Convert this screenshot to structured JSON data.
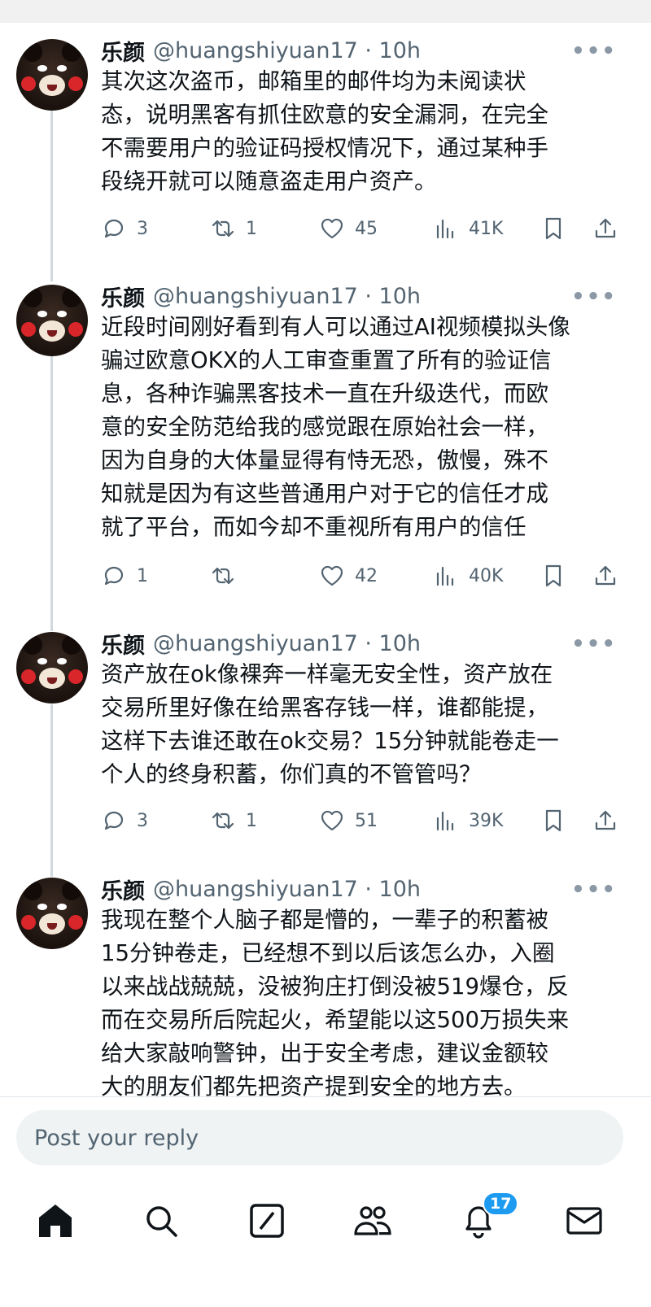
{
  "tweets": [
    {
      "name": "乐颜",
      "handle": "@huangshiyuan17 · 10h",
      "text": "其次这次盗币，邮箱里的邮件均为未阅读状\n态，说明黑客有抓住欧意的安全漏洞，在完全\n不需要用户的验证码授权情况下，通过某种手\n段绕开就可以随意盗走用户资产。",
      "replies": "3",
      "reposts": "1",
      "likes": "45",
      "views": "41K"
    },
    {
      "name": "乐颜",
      "handle": "@huangshiyuan17 · 10h",
      "text": "近段时间刚好看到有人可以通过AI视频模拟头像\n骗过欧意OKX的人工审查重置了所有的验证信\n息，各种诈骗黑客技术一直在升级迭代，而欧\n意的安全防范给我的感觉跟在原始社会一样，\n因为自身的大体量显得有恃无恐，傲慢，殊不\n知就是因为有这些普通用户对于它的信任才成\n就了平台，而如今却不重视所有用户的信任",
      "replies": "1",
      "reposts": "",
      "likes": "42",
      "views": "40K"
    },
    {
      "name": "乐颜",
      "handle": "@huangshiyuan17 · 10h",
      "text": "资产放在ok像裸奔一样毫无安全性，资产放在\n交易所里好像在给黑客存钱一样，谁都能提，\n这样下去谁还敢在ok交易？15分钟就能卷走一\n个人的终身积蓄，你们真的不管管吗？",
      "replies": "3",
      "reposts": "1",
      "likes": "51",
      "views": "39K"
    },
    {
      "name": "乐颜",
      "handle": "@huangshiyuan17 · 10h",
      "text": "我现在整个人脑子都是懵的，一辈子的积蓄被\n15分钟卷走，已经想不到以后该怎么办，入圈\n以来战战兢兢，没被狗庄打倒没被519爆仓，反\n而在交易所后院起火，希望能以这500万损失来\n给大家敲响警钟，出于安全考虑，建议金额较\n大的朋友们都先把资产提到安全的地方去。"
    }
  ],
  "reply_box": {
    "placeholder": "Post your reply"
  },
  "nav": {
    "icons": [
      "home-icon",
      "search-icon",
      "grok-icon",
      "communities-icon",
      "notifications-icon",
      "messages-icon"
    ],
    "notification_badge": "17"
  },
  "colors": {
    "accent": "#1d9bf0",
    "text": "#0f1419",
    "muted": "#536471"
  }
}
